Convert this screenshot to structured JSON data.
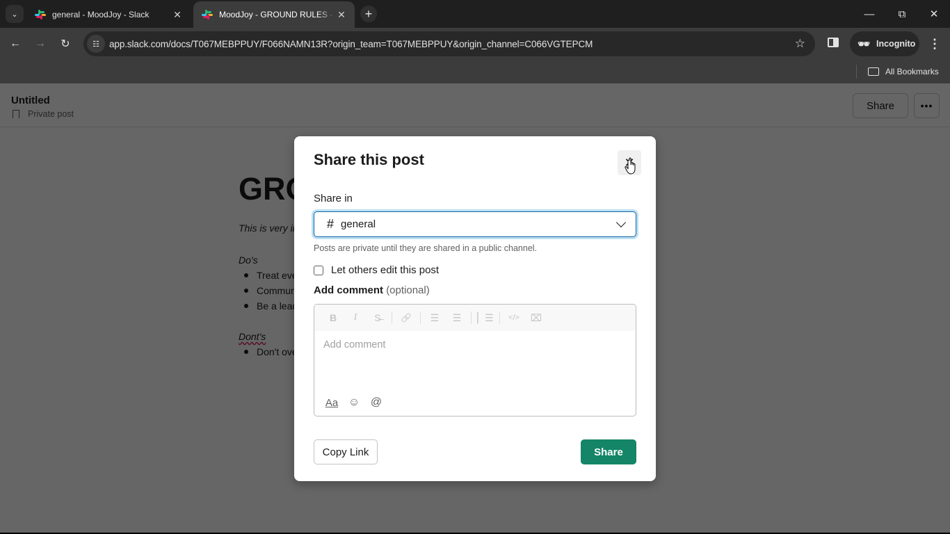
{
  "browser": {
    "tabs": [
      {
        "title": "general - MoodJoy - Slack",
        "active": false
      },
      {
        "title": "MoodJoy - GROUND RULES - Slack",
        "active": true
      }
    ],
    "url": "app.slack.com/docs/T067MEBPPUY/F066NAMN13R?origin_team=T067MEBPPUY&origin_channel=C066VGTEPCM",
    "profile_label": "Incognito",
    "bookmarks_label": "All Bookmarks",
    "icons": {
      "tab_search": "chevron-down-icon",
      "new_tab": "plus-icon",
      "back": "arrow-left-icon",
      "forward": "arrow-right-icon",
      "reload": "reload-icon",
      "site_info": "tune-icon",
      "bookmark_star": "star-icon",
      "side_panel": "side-panel-icon",
      "incognito": "incognito-icon",
      "menu": "kebab-icon",
      "minimize": "minimize-icon",
      "restore": "restore-icon",
      "close": "close-icon"
    }
  },
  "page": {
    "header": {
      "title": "Untitled",
      "subtitle": "Private post",
      "share_label": "Share",
      "more_label": "•••"
    },
    "doc": {
      "heading": "GROUND RULES",
      "intro": "This is very important",
      "dos_heading": "Do's",
      "dos": [
        "Treat everyone",
        "Communicate",
        "Be a leader"
      ],
      "donts_heading": "Dont's",
      "donts": [
        "Don't overdo"
      ]
    }
  },
  "modal": {
    "title": "Share this post",
    "close_label": "✕",
    "share_in_label": "Share in",
    "channel_prefix": "#",
    "channel_value": "general",
    "hint": "Posts are private until they are shared in a public channel.",
    "let_others_edit_label": "Let others edit this post",
    "let_others_edit_checked": false,
    "add_comment_label": "Add comment",
    "add_comment_optional": "(optional)",
    "comment_placeholder": "Add comment",
    "formatting": [
      {
        "name": "bold-icon",
        "glyph": "B"
      },
      {
        "name": "italic-icon",
        "glyph": "I"
      },
      {
        "name": "strikethrough-icon",
        "glyph": "S̶"
      },
      {
        "name": "link-icon",
        "glyph": "🔗"
      },
      {
        "name": "ordered-list-icon",
        "glyph": "☰"
      },
      {
        "name": "bulleted-list-icon",
        "glyph": "☰"
      },
      {
        "name": "blockquote-icon",
        "glyph": "▏☰"
      },
      {
        "name": "code-icon",
        "glyph": "</>"
      },
      {
        "name": "code-block-icon",
        "glyph": "⌧"
      }
    ],
    "composer_actions": [
      {
        "name": "formatting-toggle-icon",
        "glyph": "Aa"
      },
      {
        "name": "emoji-icon",
        "glyph": "☺"
      },
      {
        "name": "mention-icon",
        "glyph": "@"
      }
    ],
    "copy_link_label": "Copy Link",
    "share_label": "Share",
    "colors": {
      "primary": "#148567",
      "focus_ring": "#1264a3"
    }
  }
}
